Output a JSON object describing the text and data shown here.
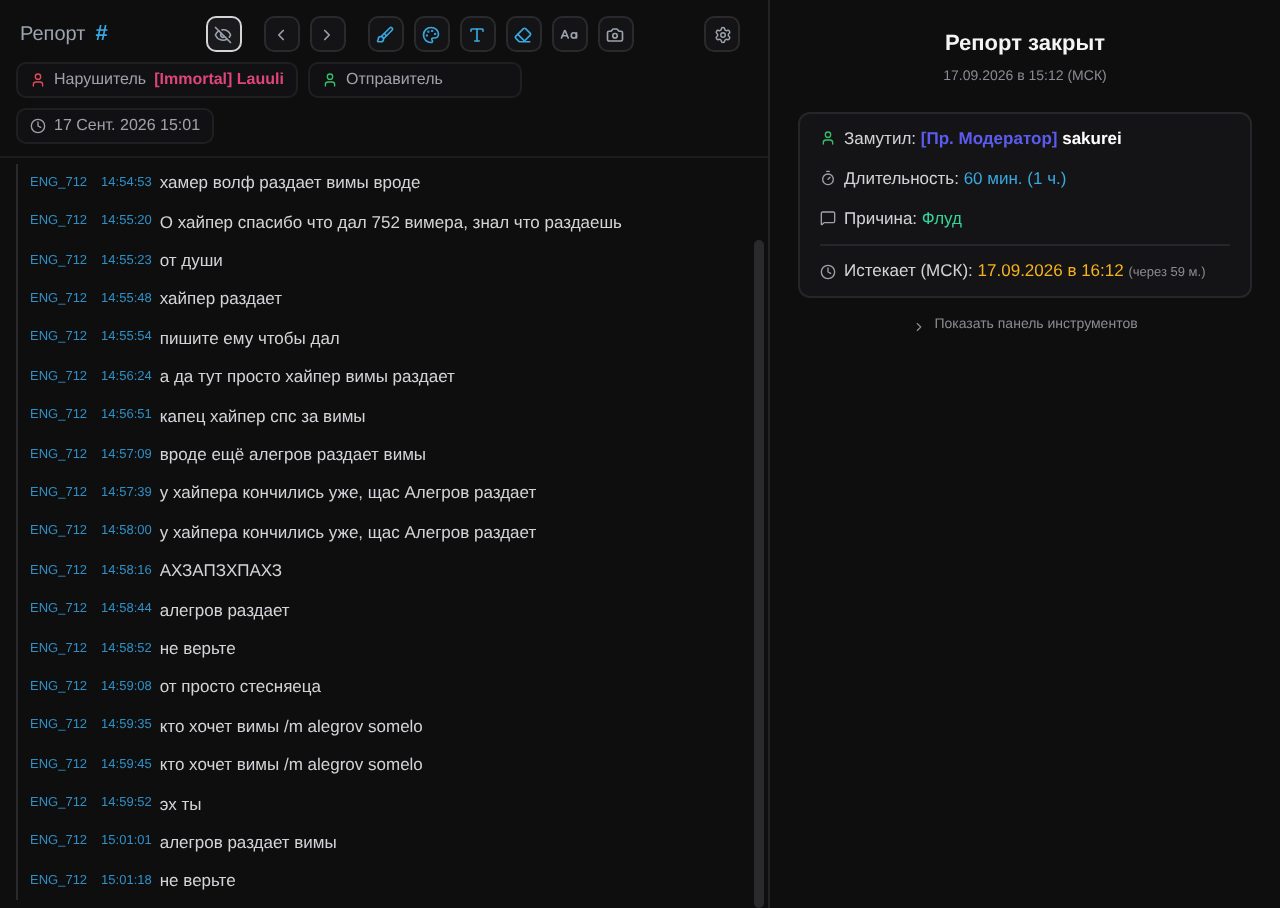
{
  "header": {
    "title": "Репорт",
    "hash": "#",
    "tools": [
      {
        "kind": "hide",
        "selected": true
      },
      {
        "kind": "prev",
        "selected": false
      },
      {
        "kind": "next",
        "selected": false
      },
      {
        "kind": "brush",
        "selected": false
      },
      {
        "kind": "palette",
        "selected": false
      },
      {
        "kind": "text",
        "selected": false
      },
      {
        "kind": "eraser",
        "selected": false
      },
      {
        "kind": "font",
        "selected": false
      },
      {
        "kind": "camera",
        "selected": false
      }
    ],
    "violator": {
      "label": "Нарушитель",
      "name": "[Immortal] Lauuli"
    },
    "sender": {
      "label": "Отправитель"
    },
    "date": "17 Сент. 2026 15:01"
  },
  "messages": [
    {
      "user": "ENG_712",
      "time": "14:54:53",
      "text": "хамер волф раздает вимы вроде"
    },
    {
      "user": "ENG_712",
      "time": "14:55:20",
      "text": "О хайпер спасибо что дал 752 вимера, знал что раздаешь"
    },
    {
      "user": "ENG_712",
      "time": "14:55:23",
      "text": "от души"
    },
    {
      "user": "ENG_712",
      "time": "14:55:48",
      "text": "хайпер раздает"
    },
    {
      "user": "ENG_712",
      "time": "14:55:54",
      "text": "пишите ему чтобы дал"
    },
    {
      "user": "ENG_712",
      "time": "14:56:24",
      "text": "а да тут просто хайпер вимы раздает"
    },
    {
      "user": "ENG_712",
      "time": "14:56:51",
      "text": "капец хайпер спс за вимы"
    },
    {
      "user": "ENG_712",
      "time": "14:57:09",
      "text": "вроде ещё алегров раздает вимы"
    },
    {
      "user": "ENG_712",
      "time": "14:57:39",
      "text": "у хайпера кончились уже, щас Алегров раздает"
    },
    {
      "user": "ENG_712",
      "time": "14:58:00",
      "text": "у хайпера кончились уже, щас Алегров раздает"
    },
    {
      "user": "ENG_712",
      "time": "14:58:16",
      "text": "АХЗАПЗХПАХЗ"
    },
    {
      "user": "ENG_712",
      "time": "14:58:44",
      "text": "алегров раздает"
    },
    {
      "user": "ENG_712",
      "time": "14:58:52",
      "text": "не верьте"
    },
    {
      "user": "ENG_712",
      "time": "14:59:08",
      "text": "от просто стесняеца"
    },
    {
      "user": "ENG_712",
      "time": "14:59:35",
      "text": "кто хочет вимы /m alegrov somelo"
    },
    {
      "user": "ENG_712",
      "time": "14:59:45",
      "text": "кто хочет вимы /m alegrov somelo"
    },
    {
      "user": "ENG_712",
      "time": "14:59:52",
      "text": "эх ты"
    },
    {
      "user": "ENG_712",
      "time": "15:01:01",
      "text": "алегров раздает вимы"
    },
    {
      "user": "ENG_712",
      "time": "15:01:18",
      "text": "не верьте"
    }
  ],
  "result": {
    "title": "Репорт закрыт",
    "date": "17.09.2026 в 15:12 (МСК)",
    "muted_by": {
      "label": "Замутил:",
      "role": "[Пр. Модератор]",
      "name": "sakurei"
    },
    "duration": {
      "label": "Длительность:",
      "value": "60 мин. (1 ч.)"
    },
    "reason": {
      "label": "Причина:",
      "value": "Флуд"
    },
    "expires": {
      "label": "Истекает (МСК):",
      "value": "17.09.2026 в 16:12",
      "note": "(через 59 м.)"
    },
    "toggle": "Показать панель инструментов"
  }
}
